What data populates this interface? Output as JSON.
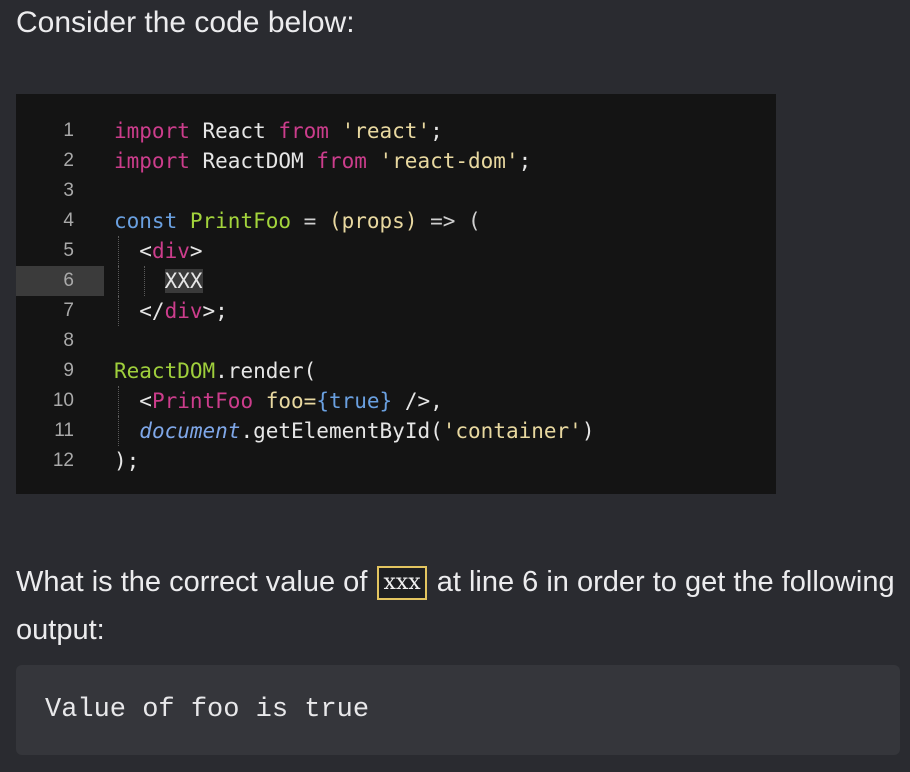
{
  "intro_text": "Consider the code below:",
  "code": {
    "highlighted_line": 6,
    "lines": [
      {
        "num": "1",
        "tokens": [
          {
            "t": "import",
            "c": "kw"
          },
          {
            "t": " React ",
            "c": "plain"
          },
          {
            "t": "from",
            "c": "kw"
          },
          {
            "t": " 'react'",
            "c": "str"
          },
          {
            "t": ";",
            "c": "plain"
          }
        ]
      },
      {
        "num": "2",
        "tokens": [
          {
            "t": "import",
            "c": "kw"
          },
          {
            "t": " ReactDOM ",
            "c": "plain"
          },
          {
            "t": "from",
            "c": "kw"
          },
          {
            "t": " 'react-dom'",
            "c": "str"
          },
          {
            "t": ";",
            "c": "plain"
          }
        ]
      },
      {
        "num": "3",
        "tokens": []
      },
      {
        "num": "4",
        "tokens": [
          {
            "t": "const",
            "c": "blue"
          },
          {
            "t": " ",
            "c": "plain"
          },
          {
            "t": "PrintFoo",
            "c": "fn"
          },
          {
            "t": " = ",
            "c": "op"
          },
          {
            "t": "(props)",
            "c": "str"
          },
          {
            "t": " => (",
            "c": "op"
          }
        ]
      },
      {
        "num": "5",
        "tokens": [
          {
            "t": "  <",
            "c": "plain"
          },
          {
            "t": "div",
            "c": "kw"
          },
          {
            "t": ">",
            "c": "plain"
          }
        ]
      },
      {
        "num": "6",
        "tokens": [
          {
            "t": "    ",
            "c": "plain"
          },
          {
            "t": "XXX",
            "c": "hl"
          }
        ]
      },
      {
        "num": "7",
        "tokens": [
          {
            "t": "  </",
            "c": "plain"
          },
          {
            "t": "div",
            "c": "kw"
          },
          {
            "t": ">;",
            "c": "plain"
          }
        ]
      },
      {
        "num": "8",
        "tokens": []
      },
      {
        "num": "9",
        "tokens": [
          {
            "t": "ReactDOM",
            "c": "green"
          },
          {
            "t": ".render(",
            "c": "plain"
          }
        ]
      },
      {
        "num": "10",
        "tokens": [
          {
            "t": "  <",
            "c": "plain"
          },
          {
            "t": "PrintFoo",
            "c": "kw"
          },
          {
            "t": " foo=",
            "c": "str"
          },
          {
            "t": "{true}",
            "c": "blue"
          },
          {
            "t": " />,",
            "c": "plain"
          }
        ]
      },
      {
        "num": "11",
        "tokens": [
          {
            "t": "  ",
            "c": "plain"
          },
          {
            "t": "document",
            "c": "it"
          },
          {
            "t": ".getElementById(",
            "c": "plain"
          },
          {
            "t": "'container'",
            "c": "str"
          },
          {
            "t": ")",
            "c": "plain"
          }
        ]
      },
      {
        "num": "12",
        "tokens": [
          {
            "t": ");",
            "c": "plain"
          }
        ]
      }
    ]
  },
  "question": {
    "before": "What is the correct value of ",
    "code": "xxx",
    "after": " at line 6 in order to get the following output:"
  },
  "output_text": "Value of foo is true",
  "colors": {
    "background": "#2a2b30",
    "code_bg": "#141414",
    "keyword": "#cc3d8c",
    "function": "#a3d43c",
    "string": "#e8d8a0",
    "highlight_border": "#e3c560"
  }
}
